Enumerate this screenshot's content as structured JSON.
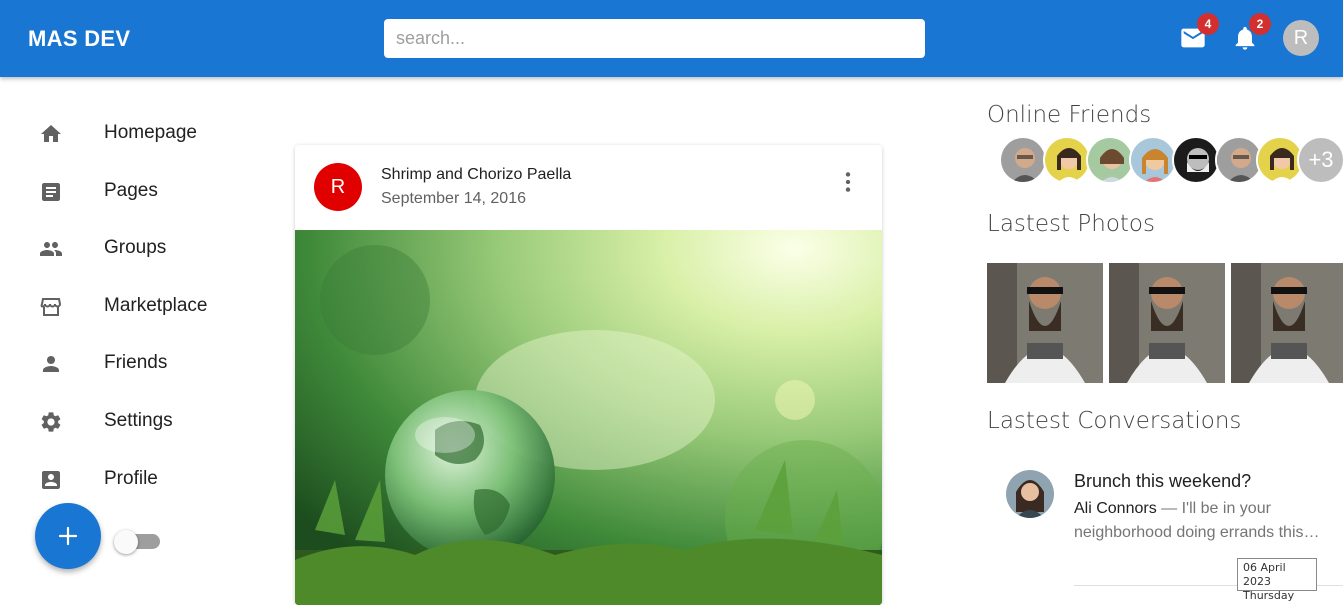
{
  "brand": "MAS DEV",
  "search": {
    "placeholder": "search..."
  },
  "header": {
    "mail_count": "4",
    "notif_count": "2",
    "avatar_initial": "R"
  },
  "sidebar": {
    "items": [
      {
        "label": "Homepage",
        "icon": "home-icon"
      },
      {
        "label": "Pages",
        "icon": "article-icon"
      },
      {
        "label": "Groups",
        "icon": "people-icon"
      },
      {
        "label": "Marketplace",
        "icon": "store-icon"
      },
      {
        "label": "Friends",
        "icon": "person-icon"
      },
      {
        "label": "Settings",
        "icon": "gear-icon"
      },
      {
        "label": "Profile",
        "icon": "account-box-icon"
      }
    ],
    "fab_label": "+"
  },
  "post": {
    "avatar_initial": "R",
    "title": "Shrimp and Chorizo Paella",
    "date": "September 14, 2016"
  },
  "online_friends": {
    "title": "Online Friends",
    "more": "+3"
  },
  "photos": {
    "title": "Lastest Photos"
  },
  "conversations": {
    "title": "Lastest Conversations",
    "items": [
      {
        "title": "Brunch this weekend?",
        "sender": "Ali Connors",
        "preview": " — I'll be in your neighborhood doing errands this…"
      }
    ]
  },
  "clock": {
    "date": "06 April 2023",
    "day": "Thursday"
  },
  "colors": {
    "primary": "#1976d2",
    "badge": "#d32f2f",
    "post_avatar": "#e00000"
  }
}
